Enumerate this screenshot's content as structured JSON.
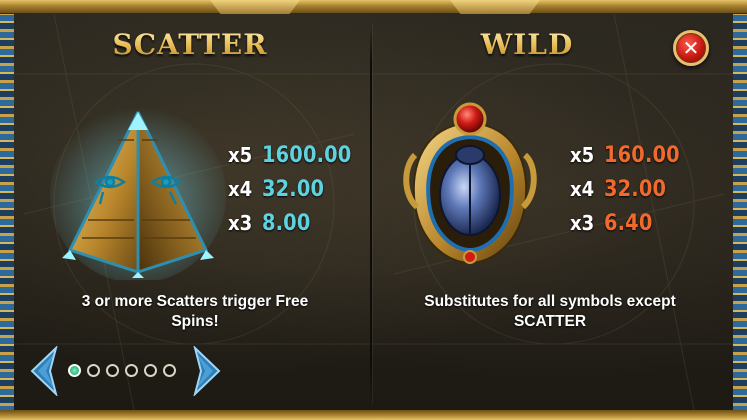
{
  "window": {
    "close_label": "✕"
  },
  "scatter": {
    "title": "SCATTER",
    "icon": "eye-pyramid-scatter-symbol",
    "payouts": [
      {
        "mult": "x5",
        "value": "1600.00"
      },
      {
        "mult": "x4",
        "value": "32.00"
      },
      {
        "mult": "x3",
        "value": "8.00"
      }
    ],
    "description_line1": "3 or more Scatters trigger Free",
    "description_line2": "Spins!",
    "payout_color": "#5fd2e0"
  },
  "wild": {
    "title": "WILD",
    "icon": "scarab-amulet-wild-symbol",
    "payouts": [
      {
        "mult": "x5",
        "value": "160.00"
      },
      {
        "mult": "x4",
        "value": "32.00"
      },
      {
        "mult": "x3",
        "value": "6.40"
      }
    ],
    "description_line1": "Substitutes for all symbols except",
    "description_line2": "SCATTER",
    "payout_color": "#f06a2e"
  },
  "pagination": {
    "page_count": 6,
    "current_page": 1,
    "prev_icon": "chevron-left-icon",
    "next_icon": "chevron-right-icon"
  },
  "colors": {
    "title_gold": "#e8c463",
    "close_red": "#c41810",
    "frame_blue": "#2b6a9b"
  }
}
